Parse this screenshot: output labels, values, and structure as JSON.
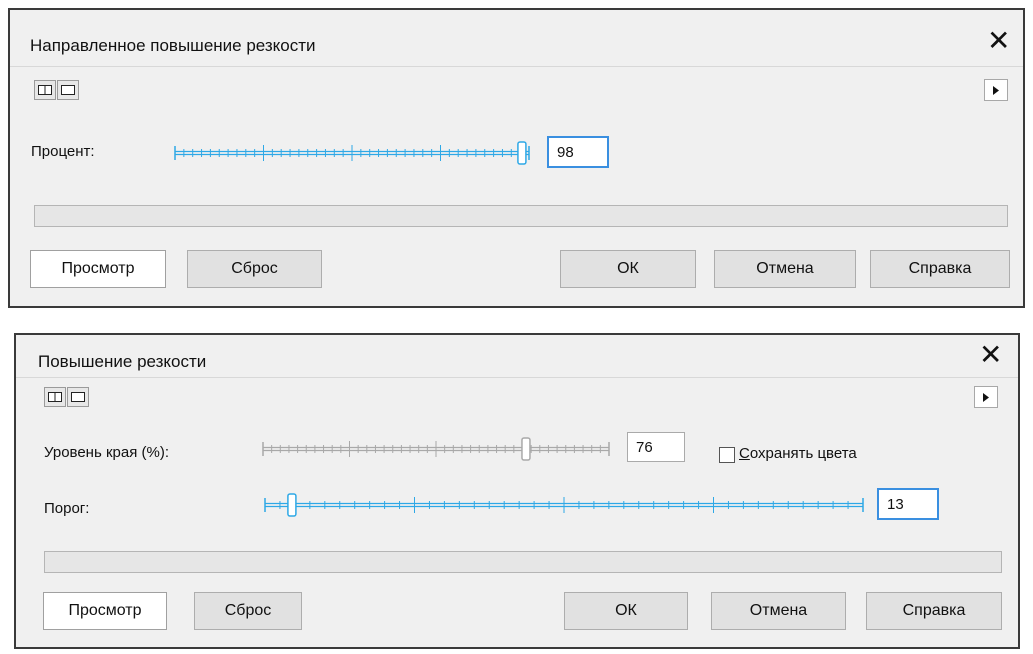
{
  "dialog1": {
    "title": "Направленное повышение резкости",
    "close_glyph": "✕",
    "percent_label": "Процент:",
    "percent_value": "98",
    "percent_level": 98,
    "buttons": {
      "preview": "Просмотр",
      "reset": "Сброс",
      "ok": "ОК",
      "cancel": "Отмена",
      "help": "Справка"
    }
  },
  "dialog2": {
    "title": "Повышение резкости",
    "close_glyph": "✕",
    "edge_label": "Уровень края (%):",
    "edge_value": "76",
    "edge_level": 76,
    "keep_colors_underlined": "С",
    "keep_colors_rest": "охранять цвета",
    "keep_colors_checked": false,
    "threshold_label": "Порог:",
    "threshold_value": "13",
    "buttons": {
      "preview": "Просмотр",
      "reset": "Сброс",
      "ok": "ОК",
      "cancel": "Отмена",
      "help": "Справка"
    }
  },
  "colors": {
    "slider_accent": "#2ea8e6",
    "slider_disabled": "#a9a9a9",
    "focus_border": "#3a8fe0"
  }
}
